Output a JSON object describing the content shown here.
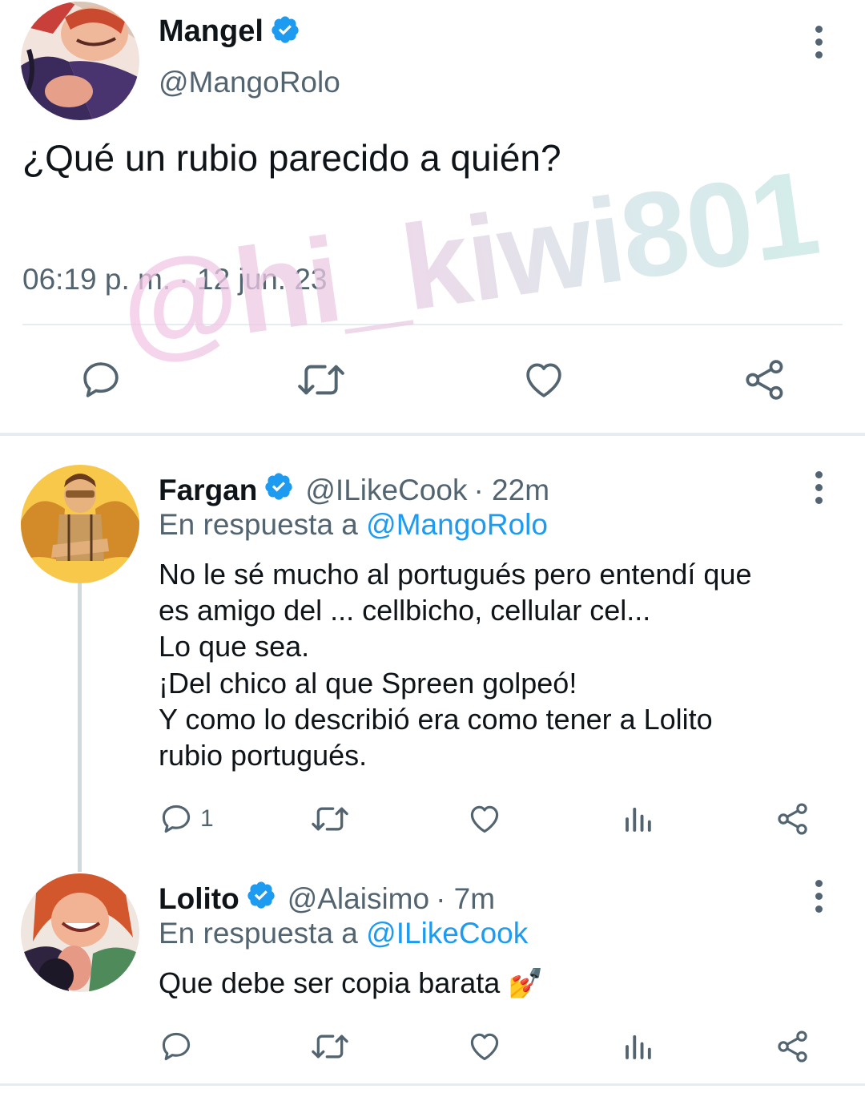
{
  "main_tweet": {
    "author_name": "Mangel",
    "author_handle": "@MangoRolo",
    "text": "¿Qué un rubio parecido a quién?",
    "timestamp": "06:19 p. m. · 12 jun. 23",
    "actions": [
      "reply-icon",
      "retweet-icon",
      "like-icon",
      "share-icon"
    ]
  },
  "replies": [
    {
      "author_name": "Fargan",
      "author_handle": "@ILikeCook",
      "age": "· 22m",
      "reply_prefix": "En respuesta a",
      "reply_to": "@MangoRolo",
      "text": "No le sé mucho al portugués pero entendí que\nes amigo del ... cellbicho, cellular cel...\nLo que sea.\n¡Del chico al que Spreen golpeó!\nY como lo describió era como tener a Lolito\nrubio portugués.",
      "reply_count": "1"
    },
    {
      "author_name": "Lolito",
      "author_handle": "@Alaisimo",
      "age": "· 7m",
      "reply_prefix": "En respuesta a",
      "reply_to": "@ILikeCook",
      "text": "Que debe ser copia barata 💅",
      "reply_count": ""
    }
  ],
  "watermark": "@hi_kiwi801",
  "colors": {
    "verified": "#1d9bf0",
    "mention": "#1d9bf0",
    "secondary_text": "#536471",
    "icon": "#536471"
  }
}
